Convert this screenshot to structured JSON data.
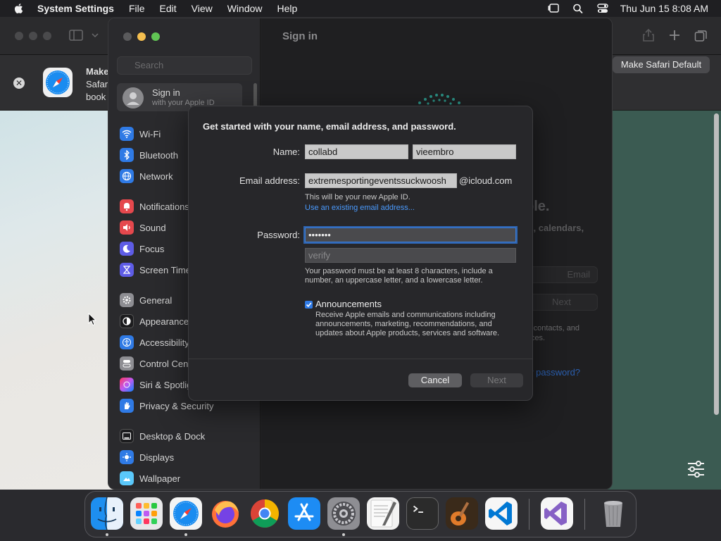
{
  "menubar": {
    "app_name": "System Settings",
    "items": [
      "File",
      "Edit",
      "View",
      "Window",
      "Help"
    ],
    "clock": "Thu Jun 15  8:08 AM"
  },
  "safari": {
    "banner_title": "Make",
    "banner_line2": "Safar",
    "banner_line3": "book",
    "default_button": "Make Safari Default"
  },
  "settings": {
    "search_placeholder": "Search",
    "signin_label": "Sign in",
    "signin_sub": "with your Apple ID",
    "main_title": "Sign in",
    "sidebar": [
      {
        "label": "Wi-Fi",
        "color": "#2f7ae5",
        "icon": "wifi-icon"
      },
      {
        "label": "Bluetooth",
        "color": "#2f7ae5",
        "icon": "bluetooth-icon"
      },
      {
        "label": "Network",
        "color": "#2f7ae5",
        "icon": "globe-icon"
      },
      {
        "label": "Notifications",
        "color": "#e5484d",
        "icon": "bell-icon"
      },
      {
        "label": "Sound",
        "color": "#e5484d",
        "icon": "speaker-icon"
      },
      {
        "label": "Focus",
        "color": "#5e5ce6",
        "icon": "moon-icon"
      },
      {
        "label": "Screen Time",
        "color": "#5e5ce6",
        "icon": "hourglass-icon"
      },
      {
        "label": "General",
        "color": "#8e8e93",
        "icon": "gear-icon"
      },
      {
        "label": "Appearance",
        "color": "#1c1c1e",
        "icon": "appearance-icon"
      },
      {
        "label": "Accessibility",
        "color": "#2f7ae5",
        "icon": "accessibility-icon"
      },
      {
        "label": "Control Centre",
        "color": "#8e8e93",
        "icon": "control-centre-icon"
      },
      {
        "label": "Siri & Spotlight",
        "color": "#bf5af2",
        "icon": "siri-icon"
      },
      {
        "label": "Privacy & Security",
        "color": "#2f7ae5",
        "icon": "hand-icon"
      },
      {
        "label": "Desktop & Dock",
        "color": "#1c1c1e",
        "icon": "dock-icon"
      },
      {
        "label": "Displays",
        "color": "#2f7ae5",
        "icon": "display-icon"
      },
      {
        "label": "Wallpaper",
        "color": "#5ac8fa",
        "icon": "wallpaper-icon"
      }
    ],
    "bg_text": {
      "ple": "ple.",
      "calendars": "ts, calendars,",
      "email_ghost": "Email",
      "next_ghost": "Next",
      "contacts": "s, contacts, and",
      "vices": "vices.",
      "forgot": "or password?"
    }
  },
  "sheet": {
    "title": "Get started with your name, email address, and password.",
    "name_label": "Name:",
    "first_name": "collabd",
    "last_name": "vieembro",
    "email_label": "Email address:",
    "email_value": "extremesportingeventssuckwoosh",
    "email_domain": "@icloud.com",
    "email_helper": "This will be your new Apple ID.",
    "email_link": "Use an existing email address...",
    "password_label": "Password:",
    "password_value": "•••••••",
    "verify_placeholder": "verify",
    "password_helper_1": "Your password must be at least 8 characters, include a",
    "password_helper_2": "number, an uppercase letter, and a lowercase letter.",
    "announcements_label": "Announcements",
    "announcements_checked": true,
    "announcements_desc_1": "Receive Apple emails and communications including",
    "announcements_desc_2": "announcements, marketing, recommendations, and",
    "announcements_desc_3": "updates about Apple products, services and software.",
    "cancel_label": "Cancel",
    "next_label": "Next"
  },
  "dock": [
    {
      "name": "finder",
      "running": true
    },
    {
      "name": "launchpad",
      "running": false
    },
    {
      "name": "safari",
      "running": true
    },
    {
      "name": "firefox",
      "running": false
    },
    {
      "name": "chrome",
      "running": false
    },
    {
      "name": "app-store",
      "running": false
    },
    {
      "name": "system-settings",
      "running": true
    },
    {
      "name": "textedit",
      "running": false
    },
    {
      "name": "terminal",
      "running": false
    },
    {
      "name": "garageband",
      "running": false
    },
    {
      "name": "vscode",
      "running": false
    },
    {
      "name": "visual-studio",
      "running": false
    },
    {
      "name": "trash",
      "running": false
    }
  ]
}
